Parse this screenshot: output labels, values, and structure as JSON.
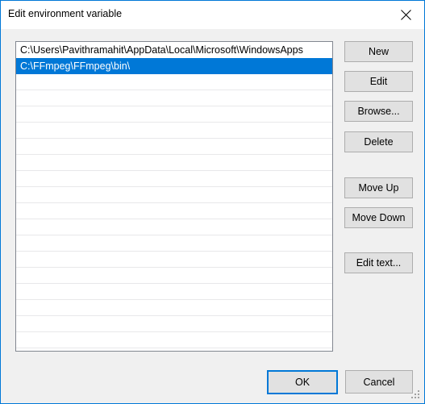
{
  "window": {
    "title": "Edit environment variable",
    "close_icon": "close-icon",
    "border_color": "#0078d7",
    "body_color": "#f0f0f0",
    "titlebar_color": "#ffffff"
  },
  "list": {
    "selection_color": "#0078d7",
    "selected_index": 1,
    "entries": [
      "C:\\Users\\Pavithramahit\\AppData\\Local\\Microsoft\\WindowsApps",
      "C:\\FFmpeg\\FFmpeg\\bin\\"
    ],
    "empty_row_count": 17
  },
  "side_buttons": {
    "new": "New",
    "edit": "Edit",
    "browse": "Browse...",
    "delete": "Delete",
    "move_up": "Move Up",
    "move_down": "Move Down",
    "edit_text": "Edit text..."
  },
  "footer": {
    "ok": "OK",
    "cancel": "Cancel",
    "default_button": "ok",
    "resize_grip_icon": "resize-grip-icon"
  }
}
